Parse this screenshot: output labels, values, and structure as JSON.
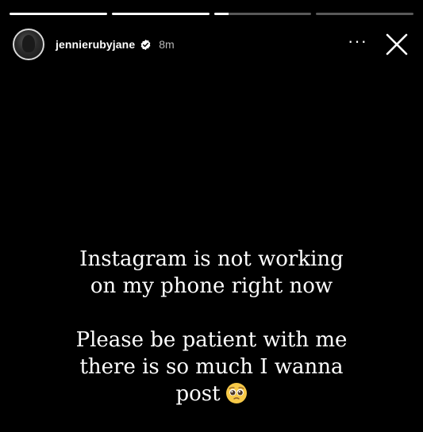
{
  "progress": {
    "segments": [
      1,
      1,
      0.15,
      0
    ]
  },
  "header": {
    "username": "jennierubyjane",
    "time": "8m",
    "more_label": "···",
    "avatar_icon": "profile-photo-icon",
    "verified_icon": "verified-badge-icon",
    "close_icon": "close-icon"
  },
  "caption": {
    "paragraph1": [
      "Instagram is not working",
      "on my phone right now"
    ],
    "paragraph2": [
      "Please be patient with me",
      "there is so much I wanna",
      "post"
    ],
    "emoji": "pleading-face-icon"
  },
  "colors": {
    "background": "#000000",
    "text": "#ffffff",
    "secondary_text": "#b8b8b8",
    "verified": "#ffffff"
  }
}
